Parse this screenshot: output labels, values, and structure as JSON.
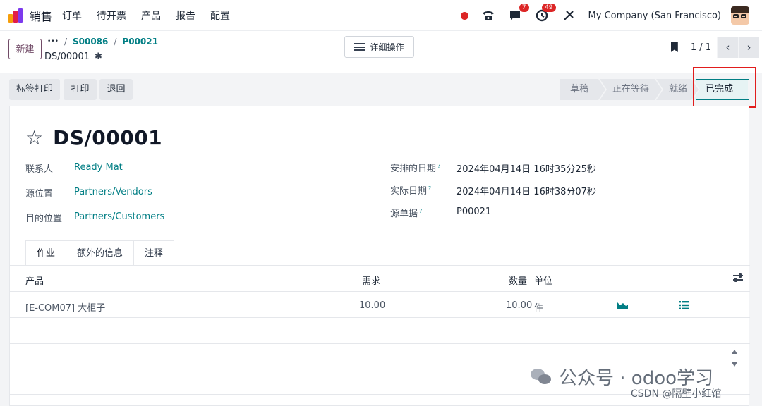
{
  "navbar": {
    "app_name": "销售",
    "menu": [
      "订单",
      "待开票",
      "产品",
      "报告",
      "配置"
    ],
    "messages_count": "7",
    "activities_count": "49",
    "company": "My Company (San Francisco)"
  },
  "control_panel": {
    "new_button": "新建",
    "breadcrumb": {
      "ellipsis": "•••",
      "items": [
        "S00086",
        "P00021"
      ]
    },
    "record_name": "DS/00001",
    "actions_button": "详细操作",
    "pager": "1 / 1"
  },
  "statusbar": {
    "buttons": [
      "标签打印",
      "打印",
      "退回"
    ],
    "stages": [
      "草稿",
      "正在等待",
      "就绪",
      "已完成"
    ],
    "active_stage": "已完成"
  },
  "form": {
    "title": "DS/00001",
    "left_fields": [
      {
        "label": "联系人",
        "value": "Ready Mat"
      },
      {
        "label": "源位置",
        "value": "Partners/Vendors"
      },
      {
        "label": "目的位置",
        "value": "Partners/Customers"
      }
    ],
    "right_fields": [
      {
        "label": "安排的日期",
        "value": "2024年04月14日 16时35分25秒"
      },
      {
        "label": "实际日期",
        "value": "2024年04月14日 16时38分07秒"
      },
      {
        "label": "源单据",
        "value": "P00021"
      }
    ],
    "help_mark": "?",
    "tabs": [
      "作业",
      "额外的信息",
      "注释"
    ],
    "active_tab": "作业"
  },
  "table": {
    "headers": {
      "product": "产品",
      "demand": "需求",
      "quantity": "数量",
      "uom": "单位"
    },
    "rows": [
      {
        "product": "[E-COM07] 大柜子",
        "demand": "10.00",
        "quantity": "10.00",
        "uom": "件"
      }
    ]
  },
  "watermark": {
    "text": "公众号 · odoo学习",
    "credit": "CSDN @隔壁小红馆"
  },
  "colors": {
    "brand": "#714b67",
    "link": "#017e84",
    "highlight_box": "#e11d1d",
    "badge": "#dc2626"
  }
}
